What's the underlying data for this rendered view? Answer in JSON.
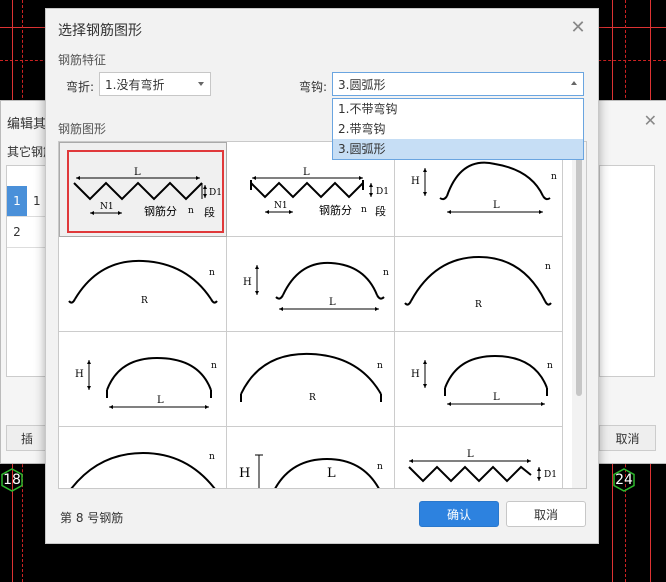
{
  "background": {
    "axis_left": "18",
    "axis_right": "24",
    "edit_dialog": {
      "title": "编辑其",
      "subtitle": "其它钢筋",
      "rows": [
        {
          "num": "1",
          "val": "1"
        },
        {
          "num": "2",
          "val": ""
        }
      ],
      "insert_label": "插",
      "cancel_label": "取消"
    }
  },
  "dialog": {
    "title": "选择钢筋图形",
    "section_features": "钢筋特征",
    "bend_label": "弯折:",
    "bend_value": "1.没有弯折",
    "hook_label": "弯钩:",
    "hook_value": "3.圆弧形",
    "hook_options": [
      {
        "label": "1.不带弯钩",
        "selected": false
      },
      {
        "label": "2.带弯钩",
        "selected": false
      },
      {
        "label": "3.圆弧形",
        "selected": true
      }
    ],
    "section_shapes": "钢筋图形",
    "shapes": {
      "L": "L",
      "D1": "D1",
      "N1": "N1",
      "H": "H",
      "R": "R",
      "n": "n",
      "segment_text": "钢筋分",
      "segment_text2": "段"
    },
    "status": "第 8 号钢筋",
    "ok_label": "确认",
    "cancel_label": "取消"
  },
  "colors": {
    "accent": "#2d82df",
    "selection_border": "#e0393b",
    "cad_red": "#d33"
  }
}
